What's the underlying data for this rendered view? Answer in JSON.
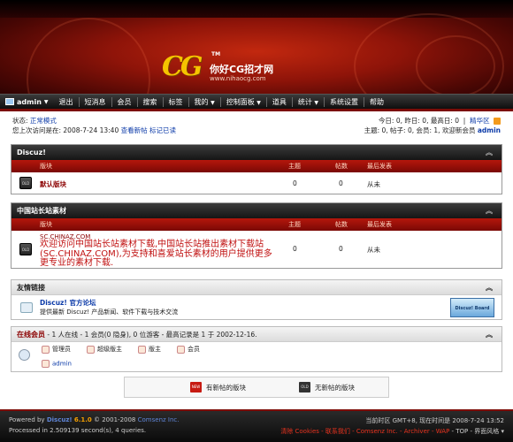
{
  "header": {
    "logo_mark": "CG",
    "logo_tm": "TM",
    "logo_text": "你好CG招才网",
    "logo_url": "www.nihaocg.com"
  },
  "nav": {
    "user": "admin",
    "items": [
      "退出",
      "短消息",
      "会员",
      "搜索",
      "标签",
      "我的",
      "控制面板",
      "道具",
      "统计",
      "系统设置",
      "帮助"
    ]
  },
  "status": {
    "mode_label": "状态:",
    "mode_value": "正常模式",
    "last_visit_label": "您上次访问是在: 2008-7-24 13:40",
    "view_new": "查看新帖",
    "mark_read": "标记已读",
    "stats_line1": "今日: 0, 昨日: 0, 最高日: 0",
    "digest": "精华区",
    "stats_line2": "主题: 0, 帖子: 0, 会员: 1, 欢迎新会员",
    "new_member": "admin"
  },
  "columns": {
    "forum": "版块",
    "threads": "主题",
    "posts": "帖数",
    "last_post": "最后发表"
  },
  "sections": [
    {
      "title": "Discuz!",
      "forum_name": "默认版块",
      "threads": "0",
      "posts": "0",
      "last_post": "从未"
    },
    {
      "title": "中国站长站素材",
      "forum_name": "SC.CHINAZ.COM",
      "forum_desc": "欢迎访问中国站长站素材下载,中国站长站推出素材下载站(SC.CHINAZ.COM),为支持和喜爱站长素材的用户提供更多更专业的素材下载.",
      "threads": "0",
      "posts": "0",
      "last_post": "从未"
    }
  ],
  "links": {
    "title": "友情链接",
    "name": "Discuz! 官方论坛",
    "desc": "提供最新 Discuz! 产品新闻、软件下载与技术交流",
    "badge": "Discuz! Board"
  },
  "online": {
    "title": "在线会员",
    "summary": " - 1 人在线 - 1 会员(0 隐身), 0 位游客 - 最高记录是 1 于 2002-12-16.",
    "roles": [
      "管理员",
      "超级版主",
      "版主",
      "会员"
    ],
    "user": "admin"
  },
  "legend": {
    "new_label": "有新帖的版块",
    "old_label": "无新帖的版块",
    "new_icon": "NEW",
    "old_icon": "OLD"
  },
  "footer": {
    "powered_prefix": "Powered by",
    "product": "Discuz!",
    "version": "6.1.0",
    "copyright": "© 2001-2008",
    "company": "Comsenz Inc.",
    "processed": "Processed in 2.509139 second(s), 4 queries.",
    "timezone": "当前时区 GMT+8, 现在时间是 2008-7-24 13:52",
    "links_left": "清除 Cookies - 联系我们 - Comsenz Inc. - Archiver - WAP",
    "links_right": " - TOP - 界面风格 ▾"
  }
}
